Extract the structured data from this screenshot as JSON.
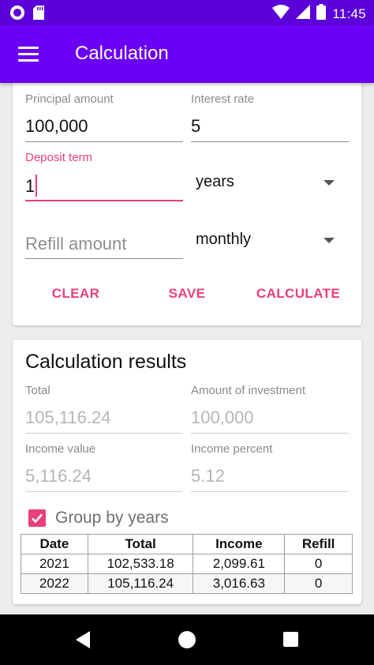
{
  "status_bar": {
    "time": "11:45",
    "icons": [
      "circle-notification-icon",
      "sd-card-icon",
      "wifi-icon",
      "signal-icon",
      "battery-icon"
    ]
  },
  "app_bar": {
    "title": "Calculation",
    "menu_icon": "hamburger-menu-icon"
  },
  "form": {
    "principal": {
      "label": "Principal amount",
      "value": "100,000"
    },
    "interest": {
      "label": "Interest rate",
      "value": "5"
    },
    "term": {
      "label": "Deposit term",
      "value": "1"
    },
    "term_unit": {
      "selected": "years"
    },
    "refill": {
      "placeholder": "Refill amount"
    },
    "refill_period": {
      "selected": "monthly"
    },
    "buttons": {
      "clear": "CLEAR",
      "save": "SAVE",
      "calculate": "CALCULATE"
    }
  },
  "results": {
    "title": "Calculation results",
    "total": {
      "label": "Total",
      "value": "105,116.24"
    },
    "investment": {
      "label": "Amount of investment",
      "value": "100,000"
    },
    "income_value": {
      "label": "Income value",
      "value": "5,116.24"
    },
    "income_percent": {
      "label": "Income percent",
      "value": "5.12"
    },
    "group_by": {
      "label": "Group by years",
      "checked": true
    },
    "table": {
      "columns": [
        "Date",
        "Total",
        "Income",
        "Refill"
      ],
      "rows": [
        [
          "2021",
          "102,533.18",
          "2,099.61",
          "0"
        ],
        [
          "2022",
          "105,116.24",
          "3,016.63",
          "0"
        ]
      ]
    }
  },
  "colors": {
    "status_bar": "#5b00d9",
    "app_bar": "#6a00f4",
    "accent": "#e9407a"
  }
}
